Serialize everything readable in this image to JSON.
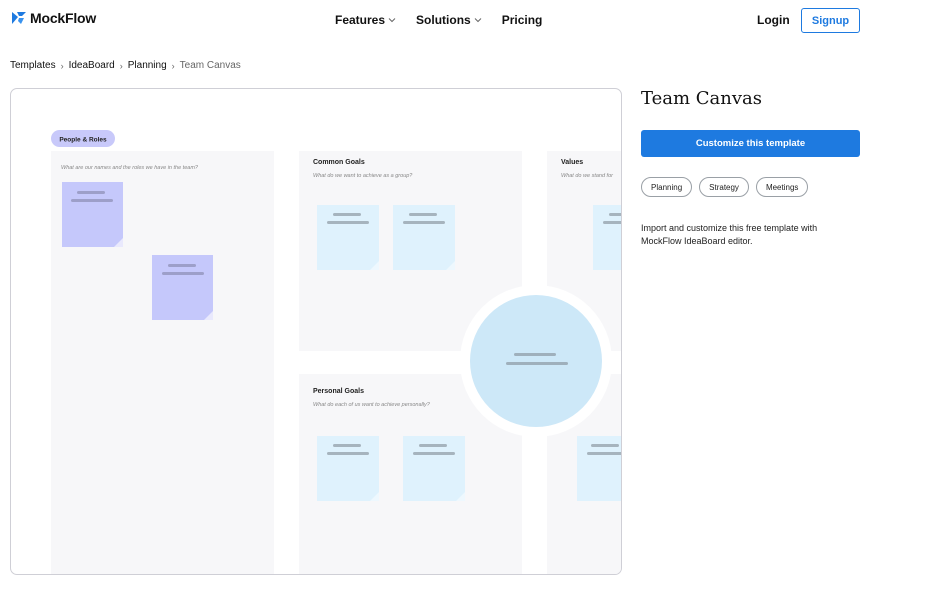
{
  "header": {
    "logo_text": "MockFlow",
    "nav": [
      {
        "label": "Features",
        "has_dropdown": true
      },
      {
        "label": "Solutions",
        "has_dropdown": true
      },
      {
        "label": "Pricing",
        "has_dropdown": false
      }
    ],
    "login_label": "Login",
    "signup_label": "Signup"
  },
  "breadcrumb": [
    "Templates",
    "IdeaBoard",
    "Planning",
    "Team Canvas"
  ],
  "preview": {
    "people_roles_tag": "People & Roles",
    "people_roles_question": "What are our names and the roles we have in the team?",
    "common_goals_title": "Common Goals",
    "common_goals_question": "What do we want to achieve as a group?",
    "values_title": "Values",
    "values_question": "What do we stand for",
    "personal_goals_title": "Personal Goals",
    "personal_goals_question": "What do each of us want to achieve personally?"
  },
  "template": {
    "title": "Team Canvas",
    "customize_label": "Customize this template",
    "tags": [
      "Planning",
      "Strategy",
      "Meetings"
    ],
    "description": "Import and customize this free template with MockFlow IdeaBoard editor."
  },
  "colors": {
    "accent": "#1e7ae0",
    "purple_note": "#c5c8fb",
    "blue_note": "#dff2fd",
    "circle": "#cde8f8",
    "panel": "#f7f7f9"
  },
  "icons": [
    "mockflow-logo-icon",
    "chevron-down-icon",
    "chevron-right-icon"
  ]
}
